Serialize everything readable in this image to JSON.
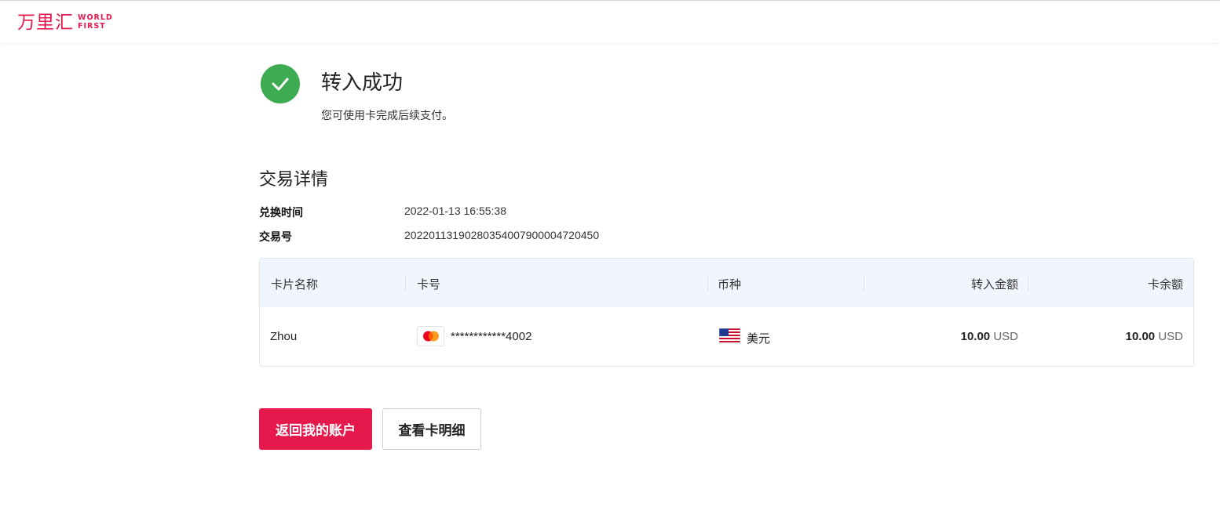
{
  "header": {
    "logo_cn": "万里汇",
    "logo_en_line1": "WORLD",
    "logo_en_line2": "FIRST",
    "brand_color": "#e5194b"
  },
  "status": {
    "icon": "check-circle-icon",
    "icon_color": "#3dab52",
    "title": "转入成功",
    "subtitle": "您可使用卡完成后续支付。"
  },
  "details": {
    "section_title": "交易详情",
    "rows": [
      {
        "label": "兑换时间",
        "value": "2022-01-13 16:55:38"
      },
      {
        "label": "交易号",
        "value": "20220113190280354007900004720450"
      }
    ]
  },
  "table": {
    "columns": [
      "卡片名称",
      "卡号",
      "币种",
      "转入金额",
      "卡余额"
    ],
    "rows": [
      {
        "card_name": "Zhou",
        "card_brand_icon": "mastercard-icon",
        "card_number": "************4002",
        "currency_flag": "us-flag-icon",
        "currency": "美元",
        "transfer_amount": "10.00",
        "transfer_currency": "USD",
        "balance_amount": "10.00",
        "balance_currency": "USD"
      }
    ]
  },
  "actions": {
    "primary_label": "返回我的账户",
    "secondary_label": "查看卡明细"
  }
}
